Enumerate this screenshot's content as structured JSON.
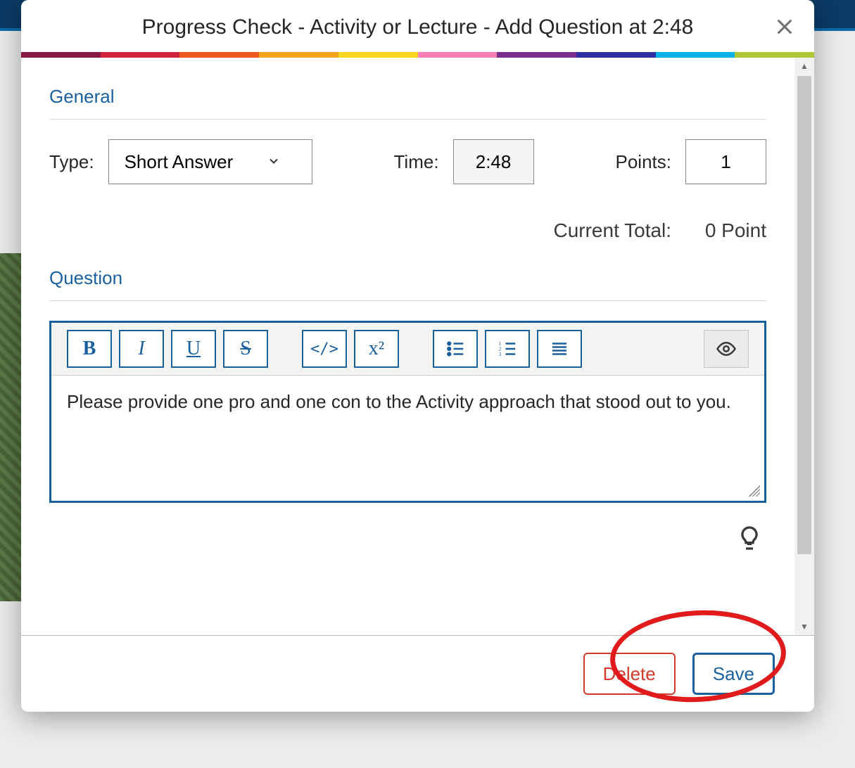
{
  "modal": {
    "title": "Progress Check - Activity or Lecture - Add Question at 2:48"
  },
  "rainbow_colors": [
    "#8a1846",
    "#d1223b",
    "#ef5a20",
    "#f6a11a",
    "#f9d61f",
    "#f77fb5",
    "#7a2e8e",
    "#2e2fa0",
    "#00b3e6",
    "#b0c533"
  ],
  "general": {
    "section_label": "General",
    "type_label": "Type:",
    "type_value": "Short Answer",
    "time_label": "Time:",
    "time_value": "2:48",
    "points_label": "Points:",
    "points_value": "1",
    "current_total_label": "Current Total:",
    "current_total_value": "0 Point"
  },
  "question": {
    "section_label": "Question",
    "content": "Please provide one pro and one con to the Activity approach that stood out to you."
  },
  "toolbar": {
    "bold": "B",
    "italic": "I",
    "underline": "U",
    "strike": "S",
    "code": "</>",
    "sup": "x²"
  },
  "footer": {
    "delete": "Delete",
    "save": "Save"
  }
}
